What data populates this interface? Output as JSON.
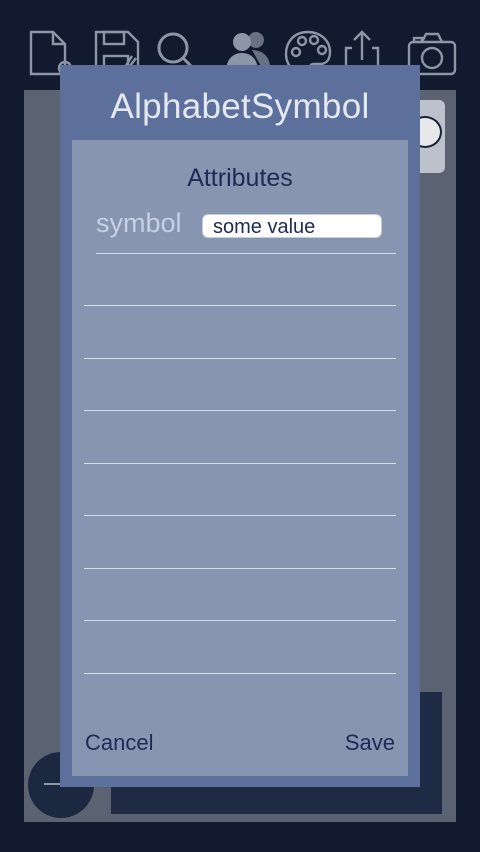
{
  "toolbar": {
    "icons": [
      "new-document-icon",
      "save-icon",
      "search-icon",
      "users-icon",
      "palette-icon",
      "share-icon",
      "camera-icon"
    ]
  },
  "dialog": {
    "title": "AlphabetSymbol",
    "section_title": "Attributes",
    "attribute": {
      "name": "symbol",
      "value": "some value"
    },
    "cancel_label": "Cancel",
    "save_label": "Save"
  },
  "colors": {
    "background": "#111a2e",
    "dialog_header": "#5d6f9b",
    "dialog_body": "#8795b1",
    "text_dark": "#1d2b55",
    "icon_stroke": "#8d95a6"
  }
}
